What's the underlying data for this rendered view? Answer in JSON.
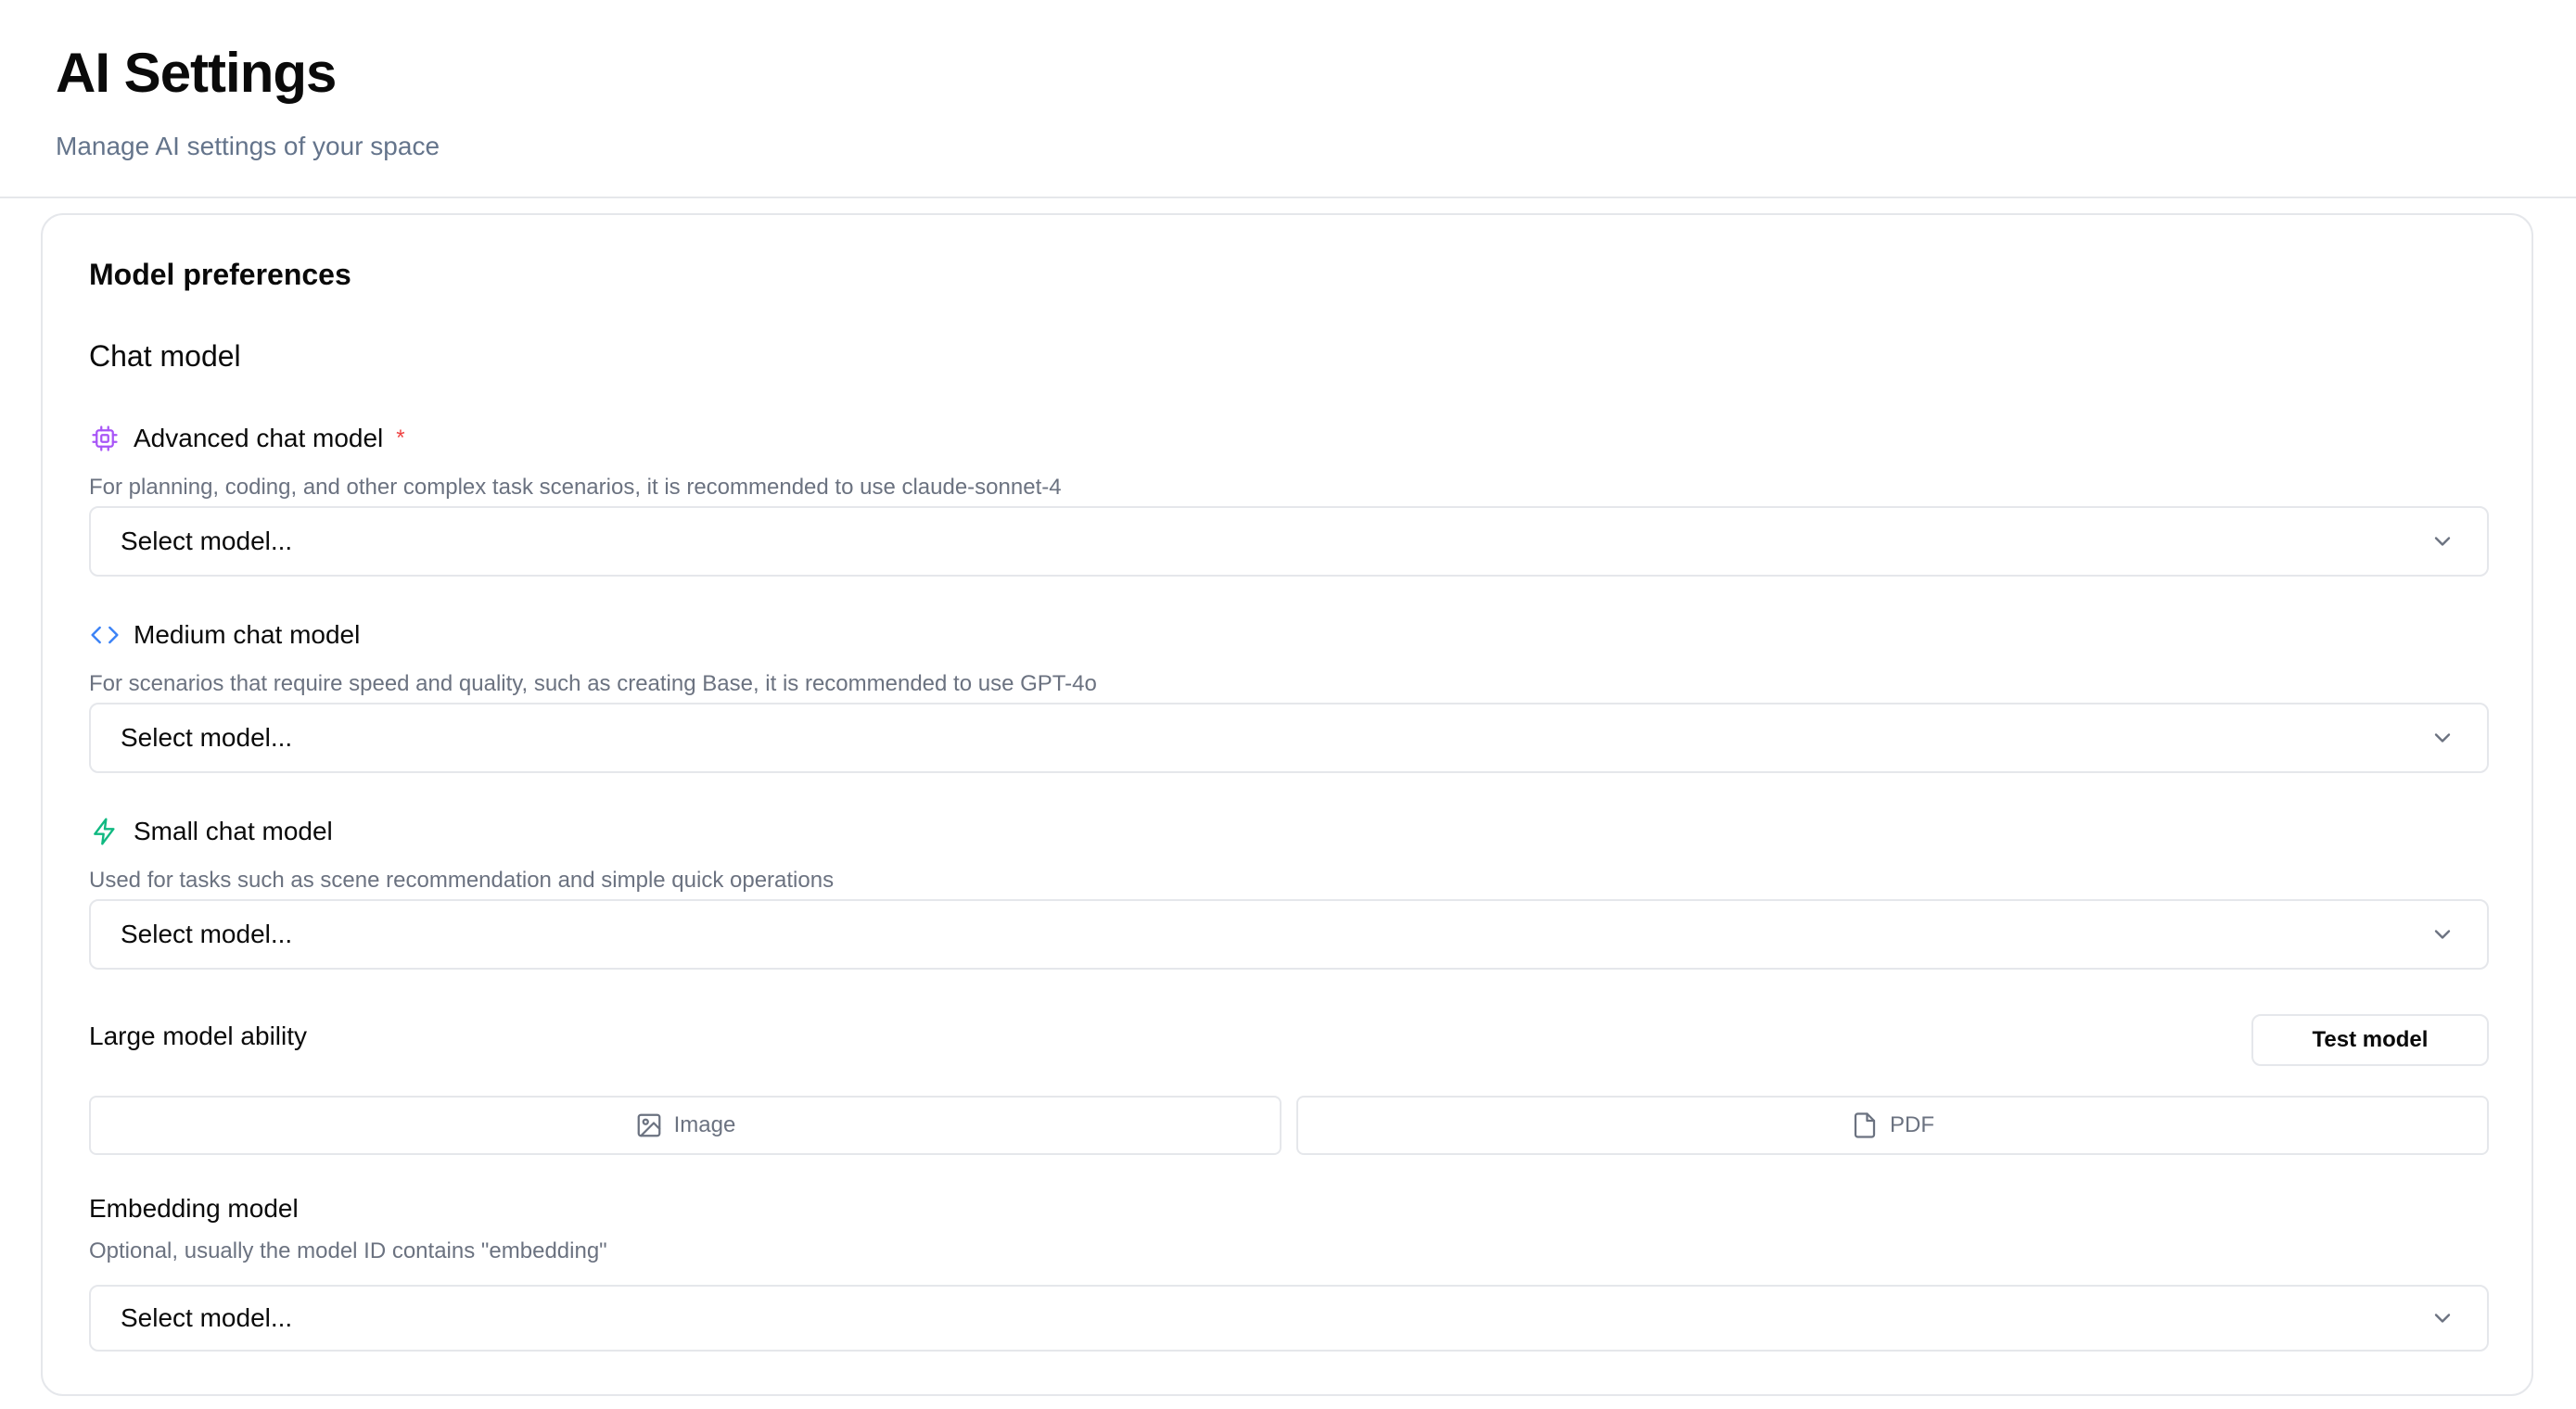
{
  "header": {
    "title": "AI Settings",
    "subtitle": "Manage AI settings of your space"
  },
  "card": {
    "title": "Model preferences",
    "chat_section_title": "Chat model"
  },
  "chat_models": [
    {
      "label": "Advanced chat model",
      "icon": "cpu-icon",
      "icon_color": "#a855f7",
      "required": "*",
      "description": "For planning, coding, and other complex task scenarios, it is recommended to use claude-sonnet-4",
      "select_value": "Select model..."
    },
    {
      "label": "Medium chat model",
      "icon": "code-icon",
      "icon_color": "#3b82f6",
      "description": "For scenarios that require speed and quality, such as creating Base, it is recommended to use GPT-4o",
      "select_value": "Select model..."
    },
    {
      "label": "Small chat model",
      "icon": "zap-icon",
      "icon_color": "#10b981",
      "description": "Used for tasks such as scene recommendation and simple quick operations",
      "select_value": "Select model..."
    }
  ],
  "ability": {
    "label": "Large model ability",
    "test_button": "Test model",
    "items": [
      {
        "label": "Image",
        "icon": "image-icon"
      },
      {
        "label": "PDF",
        "icon": "file-icon"
      }
    ]
  },
  "embedding": {
    "label": "Embedding model",
    "description": "Optional, usually the model ID contains \"embedding\"",
    "select_value": "Select model..."
  },
  "colors": {
    "border": "#e5e7eb",
    "muted_text": "#6b7280",
    "required": "#ef4444"
  }
}
